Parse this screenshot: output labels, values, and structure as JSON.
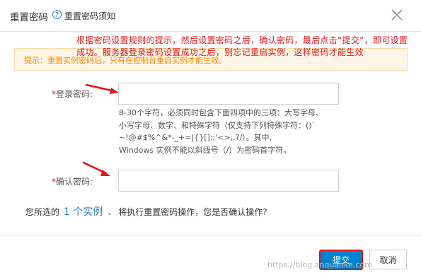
{
  "dialog": {
    "title": "重置密码",
    "help_icon": "question-icon",
    "help_link": "重置密码须知",
    "close_icon": "close-icon"
  },
  "tip": {
    "text": "提示：重置实例密码后，只有在控制台重启实例才能生效。"
  },
  "annotation": {
    "text": "根据密码设置规则的提示，然后设置密码之后，确认密码，最后点击“提交”，即可设置成功。服务器登录密码设置成功之后，别忘记重启实例，这样密码才能生效",
    "color": "#e4161b"
  },
  "form": {
    "login_password_label": "登录密码:",
    "login_password_value": "",
    "rules_line1": "8-30个字符，必须同时包含下面四项中的三项：大写字母、",
    "rules_line2": "小写字母、数字、和特殊字符（仅支持下列特殊字符：()`",
    "rules_line3": "~!@#$%^&*-_+=|{}[]:;'<>,.?/）。其中,",
    "rules_line4": "Windows 实例不能以斜线号（/）为密码首字符。",
    "confirm_password_label": "确认密码:",
    "confirm_password_value": "",
    "required_mark": "*"
  },
  "confirm": {
    "prefix": "您所选的",
    "instances_link": "1 个实例",
    "suffix": "将执行重置密码操作，您是否确认操作?"
  },
  "footer": {
    "submit_label": "提交",
    "cancel_label": "取消"
  },
  "watermark": {
    "text": "https://blog.anquanke.com"
  },
  "colors": {
    "primary": "#0084d0",
    "link": "#2b7ec9",
    "tip_text": "#ff8a00",
    "tip_bg": "#fdf5e6"
  }
}
